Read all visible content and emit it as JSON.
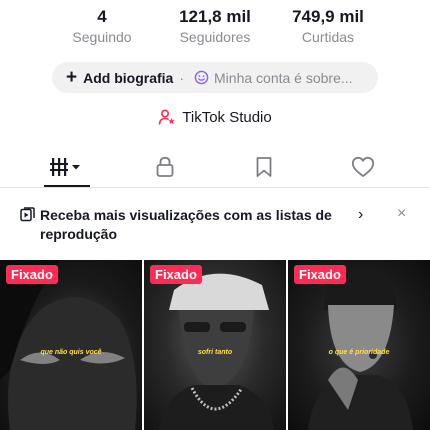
{
  "stats": [
    {
      "value": "4",
      "label": "Seguindo"
    },
    {
      "value": "121,8 mil",
      "label": "Seguidores"
    },
    {
      "value": "749,9 mil",
      "label": "Curtidas"
    }
  ],
  "bio": {
    "add_label": "Add biografia",
    "separator": "·",
    "account_label": "Minha conta é sobre..."
  },
  "studio_label": "TikTok Studio",
  "tabs": [
    {
      "icon": "videos-grid-icon",
      "active": true
    },
    {
      "icon": "lock-icon",
      "active": false
    },
    {
      "icon": "bookmark-icon",
      "active": false
    },
    {
      "icon": "heart-icon",
      "active": false
    }
  ],
  "banner": {
    "text": "Receba mais visualizações com as listas de reprodução",
    "chevron": "›",
    "close": "×"
  },
  "videos": [
    {
      "badge": "Fixado",
      "caption": "que não quis você"
    },
    {
      "badge": "Fixado",
      "caption": "sofri tanto"
    },
    {
      "badge": "Fixado",
      "caption": "o que é prioridade"
    }
  ],
  "colors": {
    "accent": "#fe2c55",
    "text": "#161823",
    "muted": "#8a8b91",
    "pill": "#f1f1f2",
    "caption": "#ffe14d"
  }
}
